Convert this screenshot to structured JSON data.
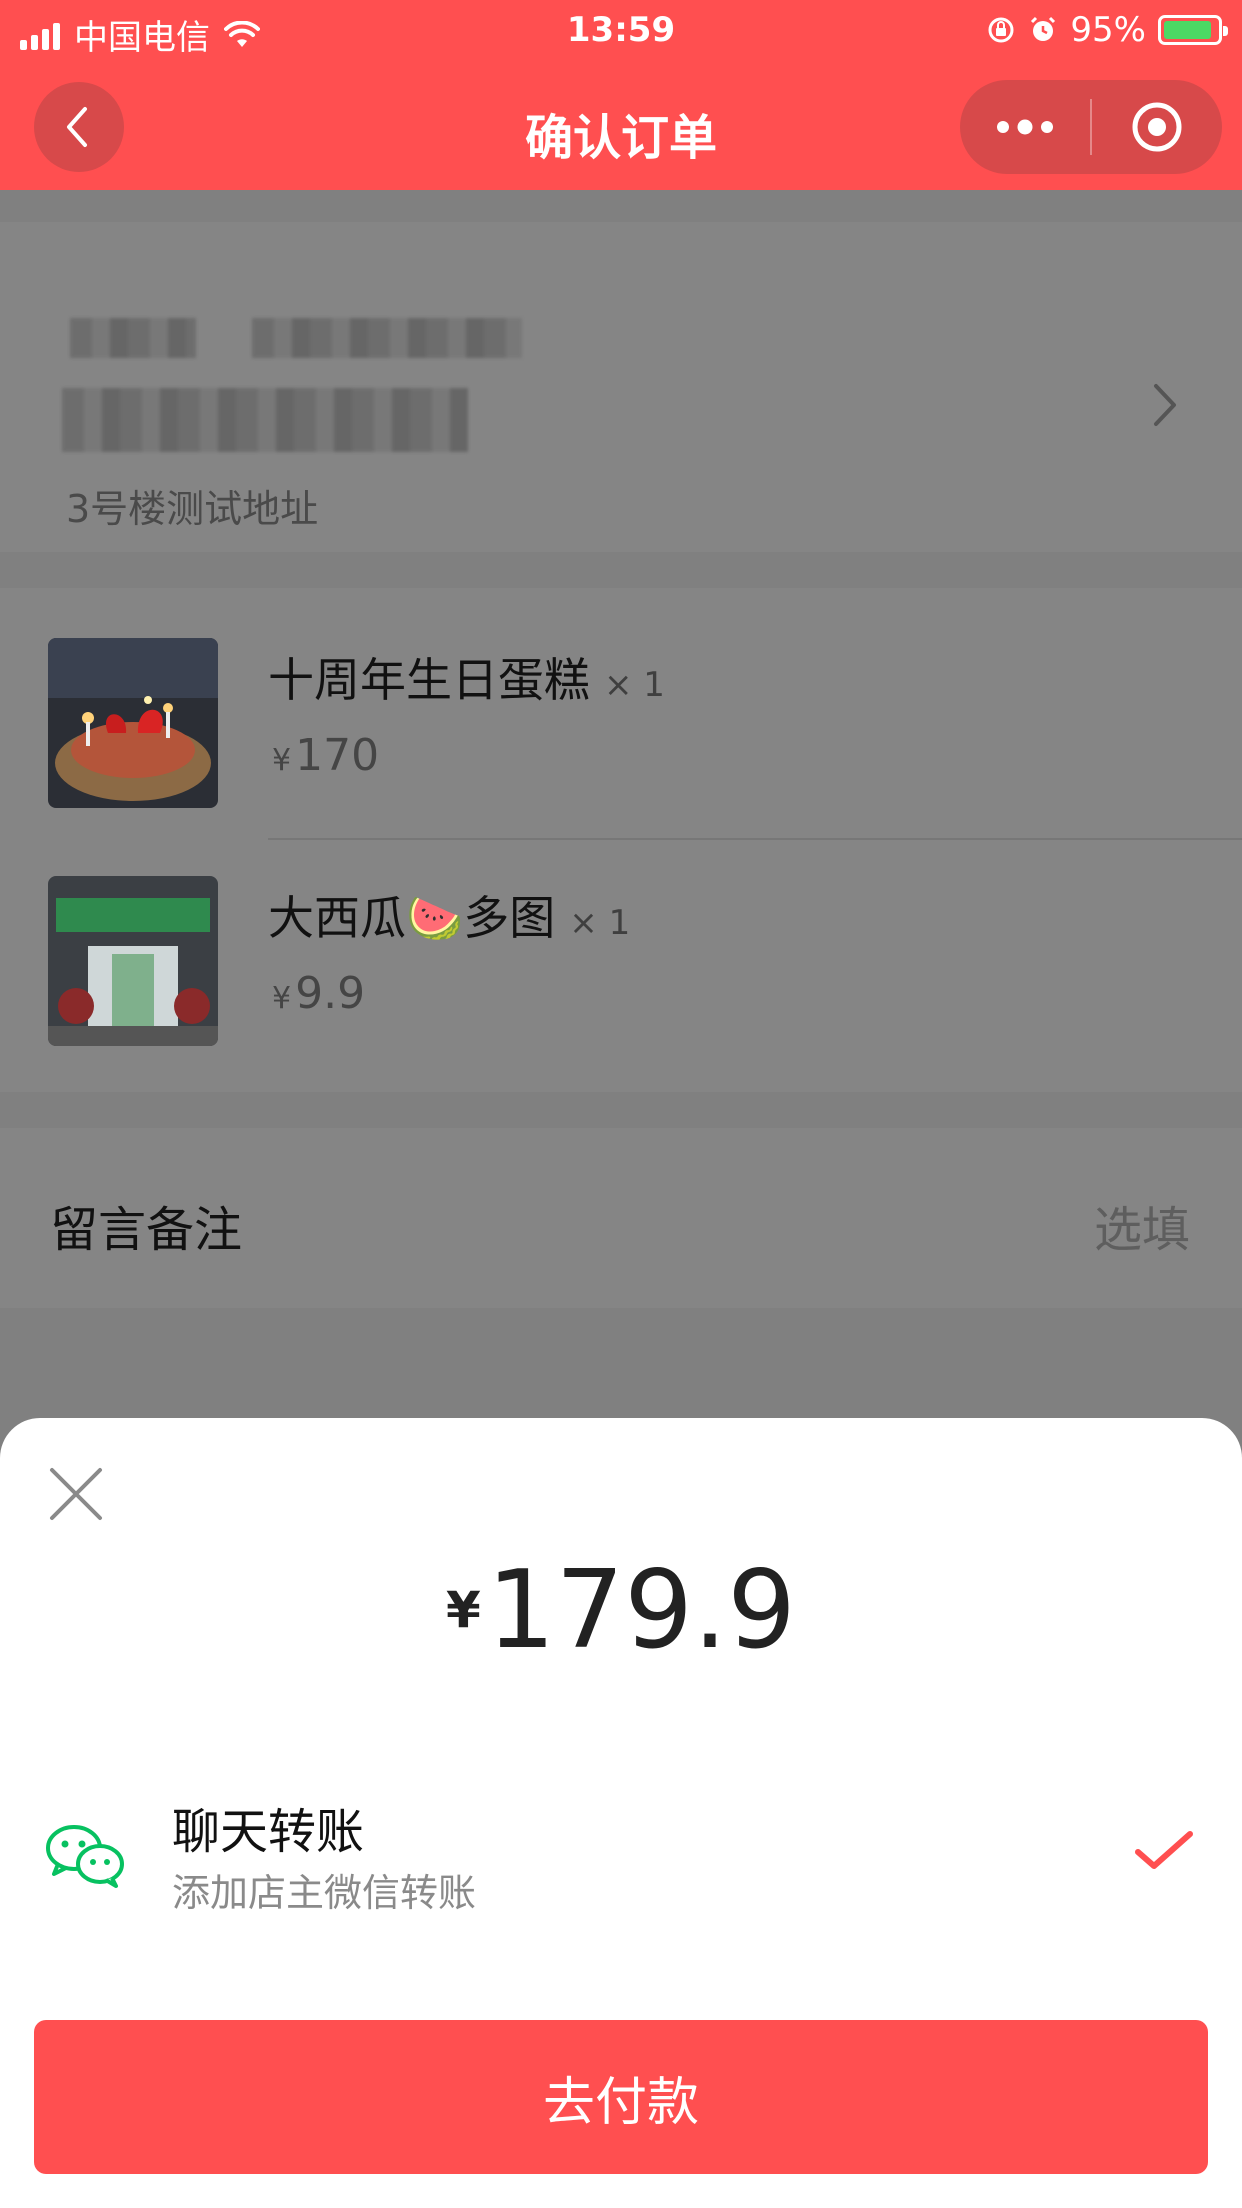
{
  "status_bar": {
    "carrier": "中国电信",
    "time": "13:59",
    "battery": "95%"
  },
  "nav": {
    "title": "确认订单",
    "back_icon": "chevron-left-icon",
    "more_icon": "more-dots-icon",
    "close_icon": "target-circle-icon"
  },
  "address": {
    "detail": "3号楼测试地址"
  },
  "goods": [
    {
      "name": "十周年生日蛋糕",
      "qty": "× 1",
      "currency": "¥",
      "price": "170"
    },
    {
      "name": "大西瓜🍉多图",
      "qty": "× 1",
      "currency": "¥",
      "price": "9.9"
    }
  ],
  "remark": {
    "label": "留言备注",
    "placeholder": "选填"
  },
  "sheet": {
    "currency": "¥",
    "amount": "179.9",
    "pay_method": {
      "title": "聊天转账",
      "description": "添加店主微信转账",
      "icon": "wechat-icon",
      "selected": true
    },
    "pay_button": "去付款"
  },
  "colors": {
    "primary": "#ff4f50",
    "wechat_green": "#07c160"
  }
}
